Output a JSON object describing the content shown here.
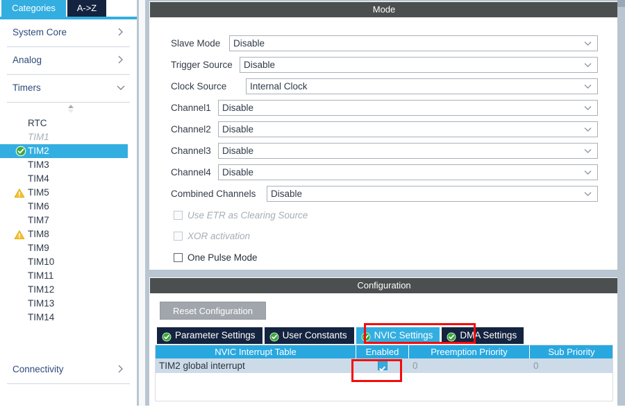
{
  "sidebar": {
    "tabs": [
      {
        "label": "Categories",
        "active": true
      },
      {
        "label": "A->Z",
        "active": false
      }
    ],
    "groups_top": [
      {
        "label": "System Core",
        "expanded": false
      },
      {
        "label": "Analog",
        "expanded": false
      },
      {
        "label": "Timers",
        "expanded": true
      }
    ],
    "tree_items": [
      {
        "label": "RTC",
        "icon": "none",
        "state": "normal"
      },
      {
        "label": "TIM1",
        "icon": "none",
        "state": "disabled"
      },
      {
        "label": "TIM2",
        "icon": "check-circle-icon",
        "state": "selected"
      },
      {
        "label": "TIM3",
        "icon": "none",
        "state": "normal"
      },
      {
        "label": "TIM4",
        "icon": "none",
        "state": "normal"
      },
      {
        "label": "TIM5",
        "icon": "warning-triangle-icon",
        "state": "normal"
      },
      {
        "label": "TIM6",
        "icon": "none",
        "state": "normal"
      },
      {
        "label": "TIM7",
        "icon": "none",
        "state": "normal"
      },
      {
        "label": "TIM8",
        "icon": "warning-triangle-icon",
        "state": "normal"
      },
      {
        "label": "TIM9",
        "icon": "none",
        "state": "normal"
      },
      {
        "label": "TIM10",
        "icon": "none",
        "state": "normal"
      },
      {
        "label": "TIM11",
        "icon": "none",
        "state": "normal"
      },
      {
        "label": "TIM12",
        "icon": "none",
        "state": "normal"
      },
      {
        "label": "TIM13",
        "icon": "none",
        "state": "normal"
      },
      {
        "label": "TIM14",
        "icon": "none",
        "state": "normal"
      }
    ],
    "groups_bottom": [
      {
        "label": "Connectivity",
        "expanded": false
      }
    ]
  },
  "mode": {
    "title": "Mode",
    "fields": [
      {
        "label": "Slave Mode",
        "value": "Disable"
      },
      {
        "label": "Trigger Source",
        "value": "Disable"
      },
      {
        "label": "Clock Source",
        "value": "Internal Clock"
      },
      {
        "label": "Channel1",
        "value": "Disable"
      },
      {
        "label": "Channel2",
        "value": "Disable"
      },
      {
        "label": "Channel3",
        "value": "Disable"
      },
      {
        "label": "Channel4",
        "value": "Disable"
      },
      {
        "label": "Combined Channels",
        "value": "Disable"
      }
    ],
    "checkboxes": [
      {
        "label": "Use ETR as Clearing Source",
        "checked": false,
        "enabled": false
      },
      {
        "label": "XOR activation",
        "checked": false,
        "enabled": false
      },
      {
        "label": "One Pulse Mode",
        "checked": false,
        "enabled": true
      }
    ]
  },
  "configuration": {
    "title": "Configuration",
    "reset_button": "Reset Configuration",
    "tabs": [
      {
        "label": "Parameter Settings",
        "active": false
      },
      {
        "label": "User Constants",
        "active": false
      },
      {
        "label": "NVIC Settings",
        "active": true
      },
      {
        "label": "DMA Settings",
        "active": false
      }
    ],
    "table": {
      "columns": [
        "NVIC Interrupt Table",
        "Enabled",
        "Preemption Priority",
        "Sub Priority"
      ],
      "rows": [
        {
          "interrupt": "TIM2 global interrupt",
          "enabled": true,
          "preemption_priority": "0",
          "sub_priority": "0"
        }
      ]
    }
  },
  "colors": {
    "accent_blue": "#33aee0",
    "tab_navy": "#14233f",
    "panel_header_grey": "#4b4f4f",
    "table_header_blue": "#29a8df",
    "table_row_blue": "#ccdbe7",
    "warning_yellow": "#f5c22b",
    "ok_green": "#3aa93a",
    "highlight_red": "#f40b0b",
    "splitter_blue_grey": "#b9c6d1"
  },
  "annotations": [
    {
      "name": "nvic-settings-tab-highlight",
      "target": "NVIC Settings"
    },
    {
      "name": "enabled-checkbox-highlight",
      "target": "Enabled"
    }
  ]
}
